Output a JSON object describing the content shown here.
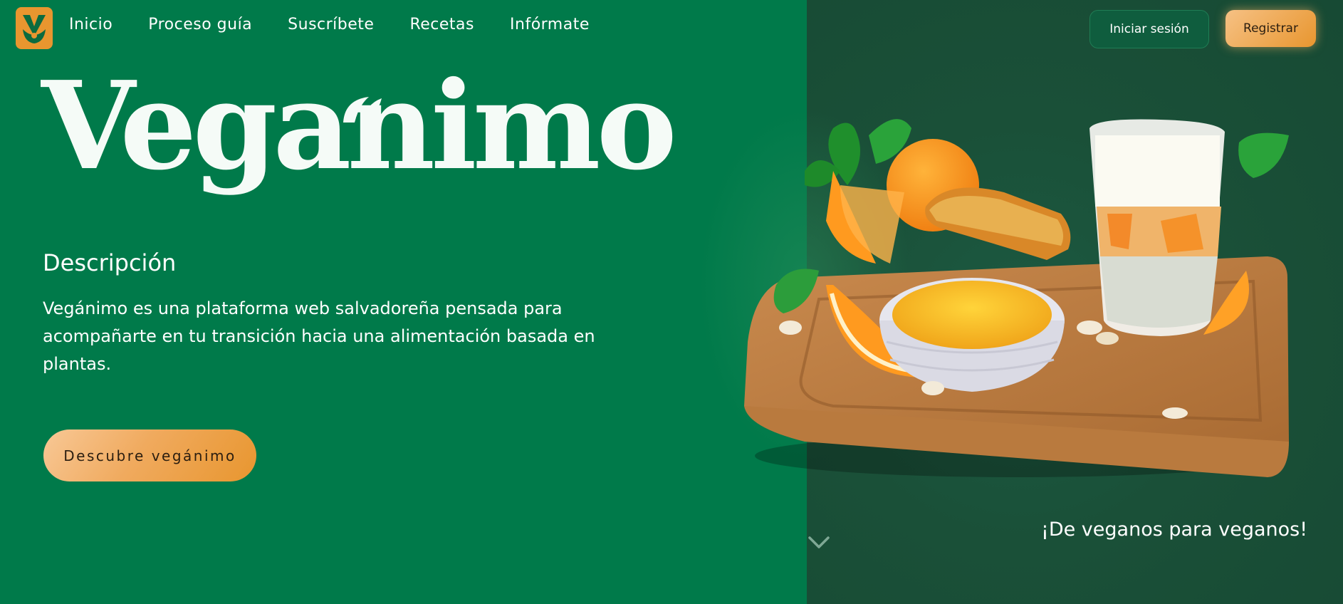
{
  "nav": {
    "items": [
      {
        "label": "Inicio"
      },
      {
        "label": "Proceso guía"
      },
      {
        "label": "Suscríbete"
      },
      {
        "label": "Recetas"
      },
      {
        "label": "Infórmate"
      }
    ],
    "login_label": "Iniciar sesión",
    "register_label": "Registrar"
  },
  "hero": {
    "brand_name": "Veganimo",
    "description_title": "Descripción",
    "description_text": "Vegánimo es una plataforma web salvadoreña pensada para acompañarte en tu transición hacia una alimentación basada en plantas.",
    "cta_label": "Descubre vegánimo",
    "tagline": "¡De veganos para veganos!"
  },
  "colors": {
    "primary_green": "#007a4a",
    "dark_green": "#174a34",
    "accent_orange": "#e8962f",
    "text_light": "#ffffff"
  },
  "icons": {
    "logo": "veganimo-logo-icon",
    "scroll": "chevron-down-icon"
  }
}
